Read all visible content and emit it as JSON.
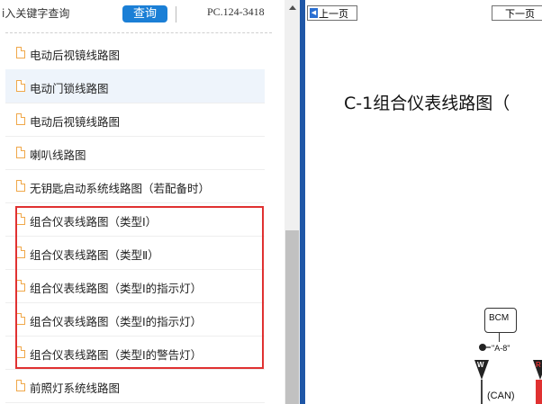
{
  "search": {
    "placeholder": "i入关键字查询",
    "button_label": "查询",
    "page_code": "PC.124-3418"
  },
  "list": {
    "items": [
      {
        "label": "电动后视镜线路图"
      },
      {
        "label": "电动门锁线路图",
        "highlighted": true
      },
      {
        "label": "电动后视镜线路图"
      },
      {
        "label": "喇叭线路图"
      },
      {
        "label": "无钥匙启动系统线路图（若配备时）"
      },
      {
        "label": "组合仪表线路图（类型Ⅰ）"
      },
      {
        "label": "组合仪表线路图（类型Ⅱ）"
      },
      {
        "label": "组合仪表线路图（类型Ⅰ的指示灯）"
      },
      {
        "label": "组合仪表线路图（类型Ⅰ的指示灯）"
      },
      {
        "label": "组合仪表线路图（类型Ⅰ的警告灯）"
      },
      {
        "label": "前照灯系统线路图"
      }
    ]
  },
  "viewer": {
    "prev_label": "上一页",
    "next_label": "下一页",
    "title": "C-1组合仪表线路图（",
    "diagram": {
      "module_label": "BCM",
      "connector_label": "\"A-8\"",
      "wire_left": "W",
      "wire_right": "R",
      "bus_label": "(CAN)"
    }
  },
  "colors": {
    "accent": "#1b7fd6",
    "frame": "#1f57a7",
    "highlight_box": "#e03131",
    "file_icon": "#f0a84a"
  },
  "icons": {
    "list_item": "file-icon",
    "prev": "arrow-left-icon",
    "scroll_up": "chevron-up-icon",
    "ground": "ground-icon"
  }
}
